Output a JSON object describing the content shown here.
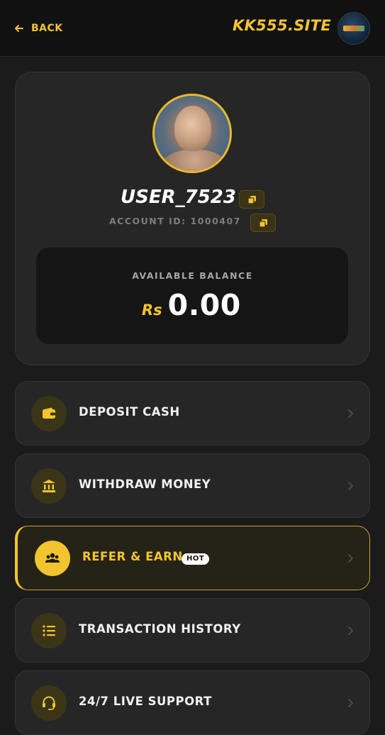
{
  "header": {
    "back_label": "BACK",
    "brand": "KK555.SITE",
    "brand_logo_icon": "site-logo-icon"
  },
  "profile": {
    "username": "USER_7523",
    "account_id": "ACCOUNT ID: 1000407",
    "balance_label": "AVAILABLE BALANCE",
    "currency": "Rs",
    "balance": "0.00"
  },
  "menu": [
    {
      "label": "DEPOSIT CASH",
      "icon": "wallet-icon"
    },
    {
      "label": "WITHDRAW MONEY",
      "icon": "bank-icon"
    },
    {
      "label": "REFER & EARN",
      "icon": "group-icon",
      "badge": "HOT",
      "active": true
    },
    {
      "label": "TRANSACTION HISTORY",
      "icon": "list-icon"
    },
    {
      "label": "24/7 LIVE SUPPORT",
      "icon": "headset-icon"
    }
  ],
  "colors": {
    "accent": "#f2c42f",
    "background": "#1b1b1b",
    "card": "#262626"
  }
}
